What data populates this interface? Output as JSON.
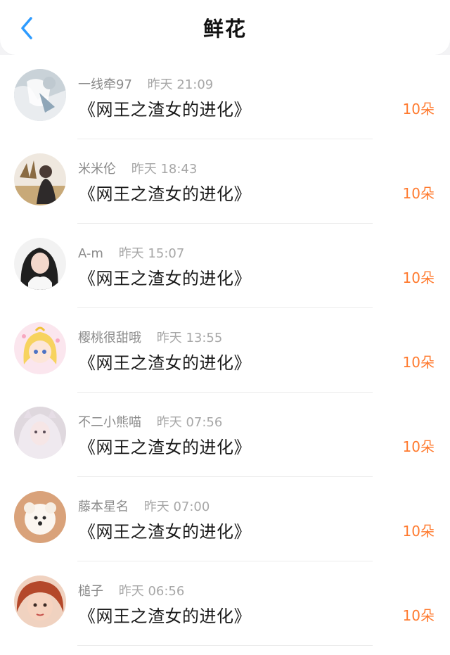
{
  "header": {
    "title": "鲜花"
  },
  "colors": {
    "accent_blue": "#2d9bff",
    "flower_count": "#ff7a2e"
  },
  "items": [
    {
      "name": "一线牵97",
      "time": "昨天 21:09",
      "book": "《网王之渣女的进化》",
      "count": "10朵"
    },
    {
      "name": "米米伦",
      "time": "昨天 18:43",
      "book": "《网王之渣女的进化》",
      "count": "10朵"
    },
    {
      "name": "A-m",
      "time": "昨天 15:07",
      "book": "《网王之渣女的进化》",
      "count": "10朵"
    },
    {
      "name": "樱桃很甜哦",
      "time": "昨天 13:55",
      "book": "《网王之渣女的进化》",
      "count": "10朵"
    },
    {
      "name": "不二小熊喵",
      "time": "昨天 07:56",
      "book": "《网王之渣女的进化》",
      "count": "10朵"
    },
    {
      "name": "藤本星名",
      "time": "昨天 07:00",
      "book": "《网王之渣女的进化》",
      "count": "10朵"
    },
    {
      "name": "槌子",
      "time": "昨天 06:56",
      "book": "《网王之渣女的进化》",
      "count": "10朵"
    }
  ]
}
